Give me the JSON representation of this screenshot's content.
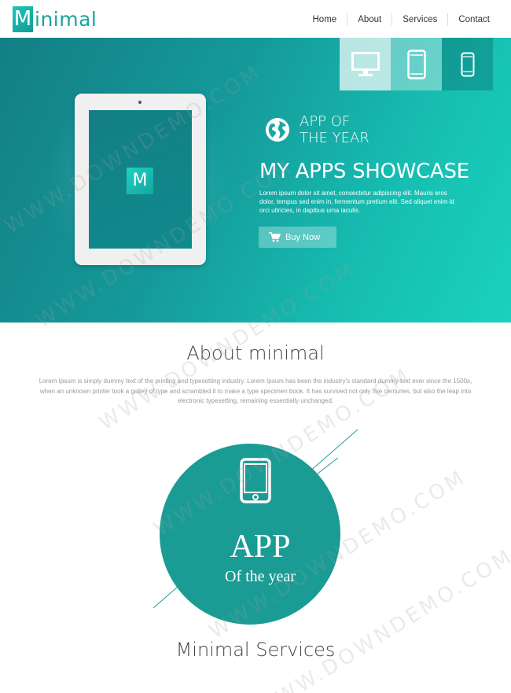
{
  "header": {
    "logo_letter": "M",
    "logo_rest": "inimal",
    "nav": [
      "Home",
      "About",
      "Services",
      "Contact"
    ]
  },
  "hero": {
    "device_tabs": [
      "desktop-icon",
      "tablet-icon",
      "phone-icon"
    ],
    "tablet_logo": "M",
    "award_line1": "APP OF",
    "award_line2": "THE YEAR",
    "title": "MY APPS SHOWCASE",
    "description": "Lorem ipsum dolor sit amet, consectetur adipiscing elit. Mauris eros dolor, tempus sed enim in, fermentum pretium elit. Sed aliquet enim id orci ultricies, in dapibus urna iaculis.",
    "buy_label": "Buy Now"
  },
  "about": {
    "title": "About minimal",
    "text": "Lorem Ipsum is simply dummy text of the printing and typesetting industry. Lorem Ipsum has been the industry's standard dummy text ever since the 1500s, when an unknown printer took a galley of type and scrambled it to make a type specimen book. It has survived not only five centuries, but also the leap into electronic typesetting, remaining essentially unchanged."
  },
  "badge": {
    "line1": "APP",
    "line2": "Of the year"
  },
  "services": {
    "title": "Minimal Services"
  },
  "watermark": "WWW.DOWNDEMO.COM",
  "colors": {
    "brand": "#16a59c",
    "hero_start": "#137f84",
    "hero_end": "#1ad2bd",
    "badge": "#1a9c94"
  }
}
